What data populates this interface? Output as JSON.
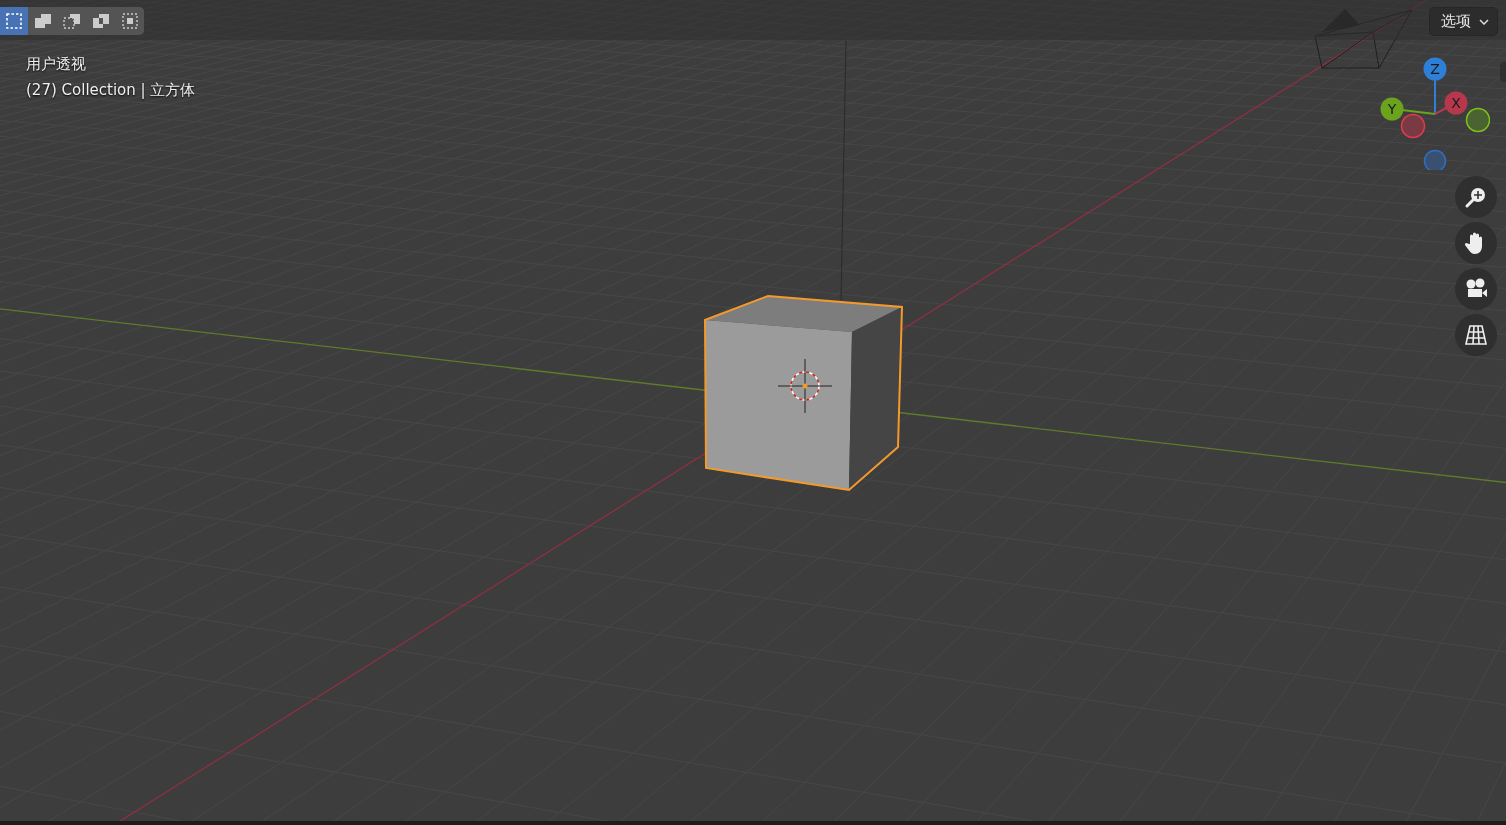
{
  "select_modes": [
    {
      "kind": "set",
      "selected": true
    },
    {
      "kind": "extend",
      "selected": false
    },
    {
      "kind": "subtract",
      "selected": false
    },
    {
      "kind": "difference",
      "selected": false
    },
    {
      "kind": "intersect",
      "selected": false
    }
  ],
  "overlay": {
    "view": "用户透视",
    "info": "(27) Collection | 立方体"
  },
  "options_button": {
    "label": "选项"
  },
  "gizmo": {
    "axes": [
      {
        "kind": "z",
        "label": "Z"
      },
      {
        "kind": "y",
        "label": "Y"
      },
      {
        "kind": "x",
        "label": "X"
      }
    ]
  },
  "nav_buttons": [
    {
      "kind": "zoom"
    },
    {
      "kind": "pan"
    },
    {
      "kind": "camera"
    },
    {
      "kind": "ortho"
    }
  ]
}
